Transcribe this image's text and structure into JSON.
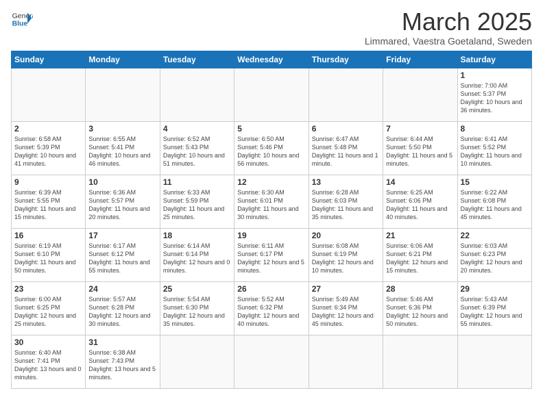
{
  "header": {
    "logo_general": "General",
    "logo_blue": "Blue",
    "month": "March 2025",
    "location": "Limmared, Vaestra Goetaland, Sweden"
  },
  "days_of_week": [
    "Sunday",
    "Monday",
    "Tuesday",
    "Wednesday",
    "Thursday",
    "Friday",
    "Saturday"
  ],
  "weeks": [
    [
      {
        "day": "",
        "info": ""
      },
      {
        "day": "",
        "info": ""
      },
      {
        "day": "",
        "info": ""
      },
      {
        "day": "",
        "info": ""
      },
      {
        "day": "",
        "info": ""
      },
      {
        "day": "",
        "info": ""
      },
      {
        "day": "1",
        "info": "Sunrise: 7:00 AM\nSunset: 5:37 PM\nDaylight: 10 hours and 36 minutes."
      }
    ],
    [
      {
        "day": "2",
        "info": "Sunrise: 6:58 AM\nSunset: 5:39 PM\nDaylight: 10 hours and 41 minutes."
      },
      {
        "day": "3",
        "info": "Sunrise: 6:55 AM\nSunset: 5:41 PM\nDaylight: 10 hours and 46 minutes."
      },
      {
        "day": "4",
        "info": "Sunrise: 6:52 AM\nSunset: 5:43 PM\nDaylight: 10 hours and 51 minutes."
      },
      {
        "day": "5",
        "info": "Sunrise: 6:50 AM\nSunset: 5:46 PM\nDaylight: 10 hours and 56 minutes."
      },
      {
        "day": "6",
        "info": "Sunrise: 6:47 AM\nSunset: 5:48 PM\nDaylight: 11 hours and 1 minute."
      },
      {
        "day": "7",
        "info": "Sunrise: 6:44 AM\nSunset: 5:50 PM\nDaylight: 11 hours and 5 minutes."
      },
      {
        "day": "8",
        "info": "Sunrise: 6:41 AM\nSunset: 5:52 PM\nDaylight: 11 hours and 10 minutes."
      }
    ],
    [
      {
        "day": "9",
        "info": "Sunrise: 6:39 AM\nSunset: 5:55 PM\nDaylight: 11 hours and 15 minutes."
      },
      {
        "day": "10",
        "info": "Sunrise: 6:36 AM\nSunset: 5:57 PM\nDaylight: 11 hours and 20 minutes."
      },
      {
        "day": "11",
        "info": "Sunrise: 6:33 AM\nSunset: 5:59 PM\nDaylight: 11 hours and 25 minutes."
      },
      {
        "day": "12",
        "info": "Sunrise: 6:30 AM\nSunset: 6:01 PM\nDaylight: 11 hours and 30 minutes."
      },
      {
        "day": "13",
        "info": "Sunrise: 6:28 AM\nSunset: 6:03 PM\nDaylight: 11 hours and 35 minutes."
      },
      {
        "day": "14",
        "info": "Sunrise: 6:25 AM\nSunset: 6:06 PM\nDaylight: 11 hours and 40 minutes."
      },
      {
        "day": "15",
        "info": "Sunrise: 6:22 AM\nSunset: 6:08 PM\nDaylight: 11 hours and 45 minutes."
      }
    ],
    [
      {
        "day": "16",
        "info": "Sunrise: 6:19 AM\nSunset: 6:10 PM\nDaylight: 11 hours and 50 minutes."
      },
      {
        "day": "17",
        "info": "Sunrise: 6:17 AM\nSunset: 6:12 PM\nDaylight: 11 hours and 55 minutes."
      },
      {
        "day": "18",
        "info": "Sunrise: 6:14 AM\nSunset: 6:14 PM\nDaylight: 12 hours and 0 minutes."
      },
      {
        "day": "19",
        "info": "Sunrise: 6:11 AM\nSunset: 6:17 PM\nDaylight: 12 hours and 5 minutes."
      },
      {
        "day": "20",
        "info": "Sunrise: 6:08 AM\nSunset: 6:19 PM\nDaylight: 12 hours and 10 minutes."
      },
      {
        "day": "21",
        "info": "Sunrise: 6:06 AM\nSunset: 6:21 PM\nDaylight: 12 hours and 15 minutes."
      },
      {
        "day": "22",
        "info": "Sunrise: 6:03 AM\nSunset: 6:23 PM\nDaylight: 12 hours and 20 minutes."
      }
    ],
    [
      {
        "day": "23",
        "info": "Sunrise: 6:00 AM\nSunset: 6:25 PM\nDaylight: 12 hours and 25 minutes."
      },
      {
        "day": "24",
        "info": "Sunrise: 5:57 AM\nSunset: 6:28 PM\nDaylight: 12 hours and 30 minutes."
      },
      {
        "day": "25",
        "info": "Sunrise: 5:54 AM\nSunset: 6:30 PM\nDaylight: 12 hours and 35 minutes."
      },
      {
        "day": "26",
        "info": "Sunrise: 5:52 AM\nSunset: 6:32 PM\nDaylight: 12 hours and 40 minutes."
      },
      {
        "day": "27",
        "info": "Sunrise: 5:49 AM\nSunset: 6:34 PM\nDaylight: 12 hours and 45 minutes."
      },
      {
        "day": "28",
        "info": "Sunrise: 5:46 AM\nSunset: 6:36 PM\nDaylight: 12 hours and 50 minutes."
      },
      {
        "day": "29",
        "info": "Sunrise: 5:43 AM\nSunset: 6:39 PM\nDaylight: 12 hours and 55 minutes."
      }
    ],
    [
      {
        "day": "30",
        "info": "Sunrise: 6:40 AM\nSunset: 7:41 PM\nDaylight: 13 hours and 0 minutes."
      },
      {
        "day": "31",
        "info": "Sunrise: 6:38 AM\nSunset: 7:43 PM\nDaylight: 13 hours and 5 minutes."
      },
      {
        "day": "",
        "info": ""
      },
      {
        "day": "",
        "info": ""
      },
      {
        "day": "",
        "info": ""
      },
      {
        "day": "",
        "info": ""
      },
      {
        "day": "",
        "info": ""
      }
    ]
  ]
}
